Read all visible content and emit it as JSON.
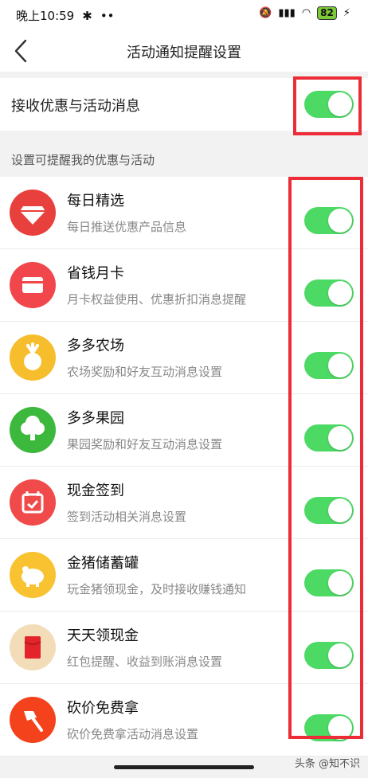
{
  "status": {
    "time": "晚上10:59",
    "battery": "82"
  },
  "header": {
    "title": "活动通知提醒设置"
  },
  "main_toggle": {
    "label": "接收优惠与活动消息",
    "on": true
  },
  "section": {
    "label": "设置可提醒我的优惠与活动"
  },
  "items": [
    {
      "title": "每日精选",
      "subtitle": "每日推送优惠产品信息",
      "icon": "diamond-icon",
      "color": "#e8403d",
      "on": true
    },
    {
      "title": "省钱月卡",
      "subtitle": "月卡权益使用、优惠折扣消息提醒",
      "icon": "card-icon",
      "color": "#f1474c",
      "on": true
    },
    {
      "title": "多多农场",
      "subtitle": "农场奖励和好友互动消息设置",
      "icon": "radish-icon",
      "color": "#f6be2c",
      "on": true
    },
    {
      "title": "多多果园",
      "subtitle": "果园奖励和好友互动消息设置",
      "icon": "tree-icon",
      "color": "#3cb83c",
      "on": true
    },
    {
      "title": "现金签到",
      "subtitle": "签到活动相关消息设置",
      "icon": "calendar-icon",
      "color": "#f04a4a",
      "on": true
    },
    {
      "title": "金猪储蓄罐",
      "subtitle": "玩金猪领现金，及时接收赚钱通知",
      "icon": "piggy-bank-icon",
      "color": "#f8c230",
      "on": true
    },
    {
      "title": "天天领现金",
      "subtitle": "红包提醒、收益到账消息设置",
      "icon": "red-envelope-icon",
      "color": "#f3ddb9",
      "on": true
    },
    {
      "title": "砍价免费拿",
      "subtitle": "砍价免费拿活动消息设置",
      "icon": "axe-icon",
      "color": "#f4431c",
      "on": true
    }
  ],
  "watermark": "头条 @知不识"
}
